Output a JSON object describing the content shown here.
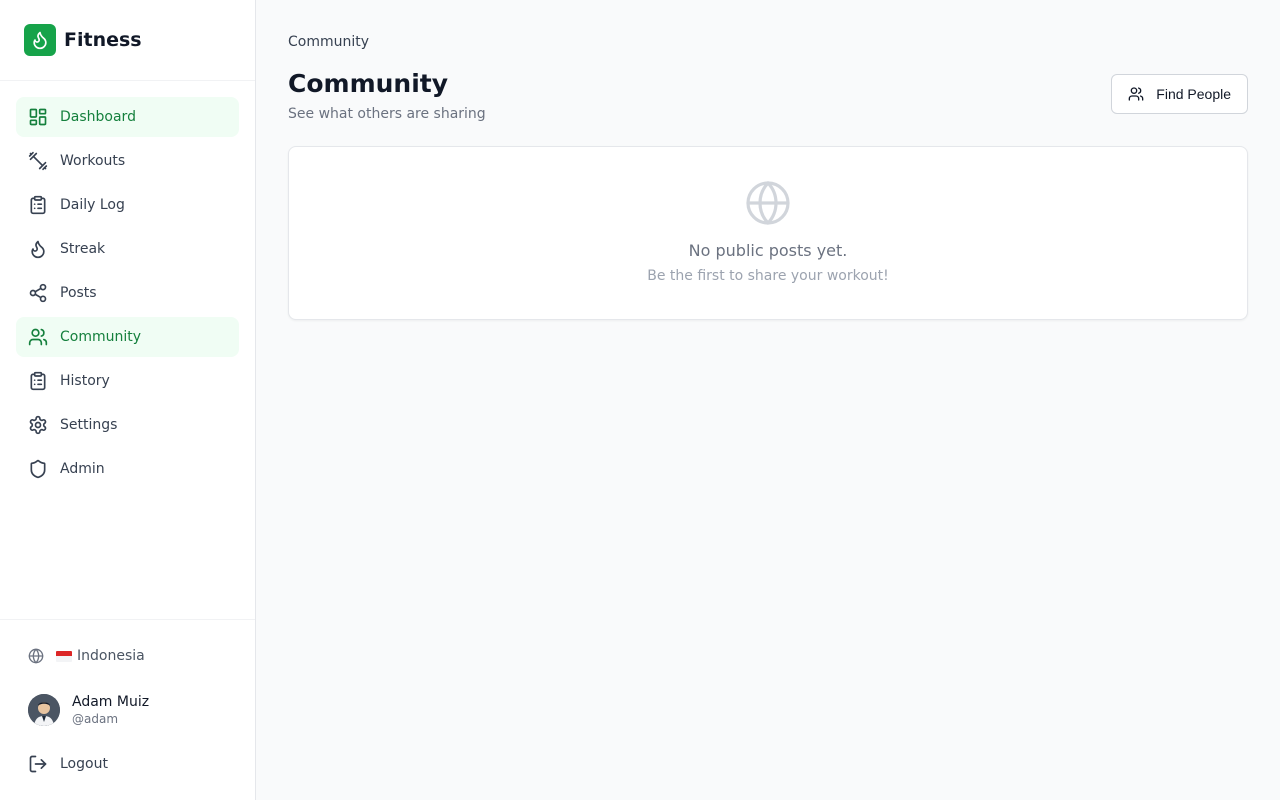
{
  "app": {
    "name": "Fitness",
    "brand_color": "#16a34a",
    "logo_icon": "flame-icon"
  },
  "sidebar": {
    "items": [
      {
        "label": "Dashboard",
        "icon": "dashboard-icon",
        "active": true
      },
      {
        "label": "Workouts",
        "icon": "dumbbell-icon",
        "active": false
      },
      {
        "label": "Daily Log",
        "icon": "clipboard-icon",
        "active": false
      },
      {
        "label": "Streak",
        "icon": "flame-icon",
        "active": false
      },
      {
        "label": "Posts",
        "icon": "share-icon",
        "active": false
      },
      {
        "label": "Community",
        "icon": "users-icon",
        "active": true
      },
      {
        "label": "History",
        "icon": "clipboard-list-icon",
        "active": false
      },
      {
        "label": "Settings",
        "icon": "gear-icon",
        "active": false
      },
      {
        "label": "Admin",
        "icon": "shield-icon",
        "active": false
      }
    ],
    "language": {
      "flag": "🇮🇩",
      "label": "Indonesia",
      "icon": "globe-icon"
    },
    "user": {
      "name": "Adam Muiz",
      "handle": "@adam"
    },
    "logout_label": "Logout"
  },
  "main": {
    "breadcrumb": "Community",
    "title": "Community",
    "subtitle": "See what others are sharing",
    "find_button_label": "Find People",
    "empty": {
      "title": "No public posts yet.",
      "subtitle": "Be the first to share your workout!",
      "icon": "globe-icon"
    }
  }
}
